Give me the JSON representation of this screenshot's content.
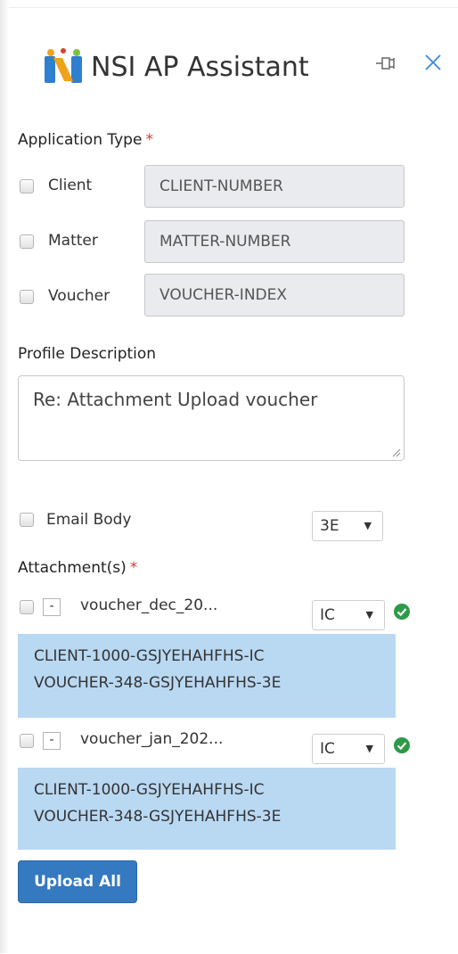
{
  "header": {
    "title": "NSI AP Assistant",
    "logo_icon": "nsi-logo-icon",
    "pin_icon": "pin-icon",
    "close_icon": "close-icon"
  },
  "application_type": {
    "label": "Application Type",
    "required_mark": "*",
    "rows": [
      {
        "label": "Client",
        "value": "CLIENT-NUMBER"
      },
      {
        "label": "Matter",
        "value": "MATTER-NUMBER"
      },
      {
        "label": "Voucher",
        "value": "VOUCHER-INDEX"
      }
    ]
  },
  "profile_description": {
    "label": "Profile Description",
    "value": "Re: Attachment Upload voucher"
  },
  "email_body": {
    "label": "Email Body",
    "select_value": "3E"
  },
  "attachments": {
    "label": "Attachment(s)",
    "required_mark": "*",
    "items": [
      {
        "collapse_label": "-",
        "file_name": "voucher_dec_20...",
        "select_value": "IC",
        "lines": [
          "CLIENT-1000-GSJYEHAHFHS-IC",
          "VOUCHER-348-GSJYEHAHFHS-3E"
        ]
      },
      {
        "collapse_label": "-",
        "file_name": "voucher_jan_202...",
        "select_value": "IC",
        "lines": [
          "CLIENT-1000-GSJYEHAHFHS-IC",
          "VOUCHER-348-GSJYEHAHFHS-3E"
        ]
      }
    ]
  },
  "actions": {
    "upload_all": "Upload All"
  },
  "colors": {
    "accent": "#3579c0",
    "info_bg": "#b9d8f2",
    "required": "#d23b3b",
    "success": "#2e9a48",
    "readonly_bg": "#e9ebee"
  }
}
